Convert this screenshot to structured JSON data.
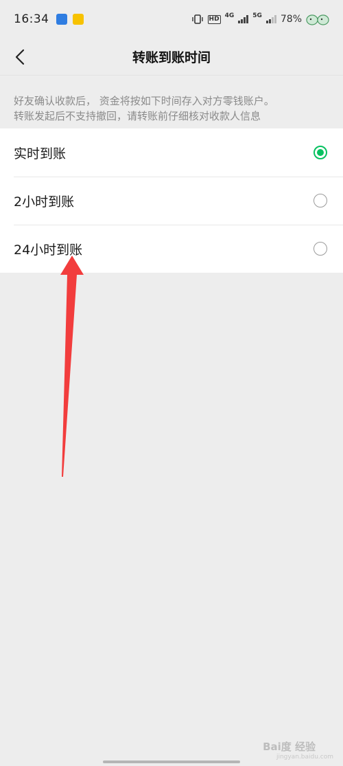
{
  "status_bar": {
    "time": "16:34",
    "network_a": "4G",
    "network_b": "5G",
    "hd_label": "HD",
    "battery": "78%"
  },
  "nav": {
    "title": "转账到账时间",
    "back_icon": "chevron-left-icon"
  },
  "notice": {
    "line1": "好友确认收款后， 资金将按如下时间存入对方零钱账户。",
    "line2": "转账发起后不支持撤回，请转账前仔细核对收款人信息"
  },
  "options": [
    {
      "label": "实时到账",
      "selected": true
    },
    {
      "label": "2小时到账",
      "selected": false
    },
    {
      "label": "24小时到账",
      "selected": false
    }
  ],
  "watermark": {
    "brand": "Bai度 经验",
    "url": "jingyan.baidu.com"
  },
  "colors": {
    "accent": "#07c160",
    "annotation_arrow": "#f23d3d",
    "background": "#ededed"
  }
}
